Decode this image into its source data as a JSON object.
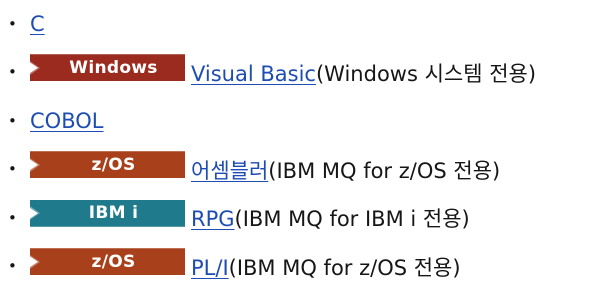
{
  "colors": {
    "link": "#1d4cb3",
    "text": "#161616",
    "badge_windows": "#9b2a1f",
    "badge_zos": "#a8401c",
    "badge_ibmi": "#1f7a8c"
  },
  "items": [
    {
      "link": "C",
      "suffix": "",
      "badge": null
    },
    {
      "link": "Visual Basic",
      "suffix": "(Windows 시스템 전용)",
      "badge": {
        "label": "Windows",
        "color": "#9b2a1f"
      }
    },
    {
      "link": "COBOL",
      "suffix": "",
      "badge": null
    },
    {
      "link": "어셈블러",
      "suffix": "(IBM MQ for z/OS 전용)",
      "badge": {
        "label": "z/OS",
        "color": "#a8401c"
      }
    },
    {
      "link": "RPG",
      "suffix": "(IBM MQ for IBM i 전용)",
      "badge": {
        "label": "IBM i",
        "color": "#1f7a8c"
      }
    },
    {
      "link": "PL/I",
      "suffix": "(IBM MQ for z/OS 전용)",
      "badge": {
        "label": "z/OS",
        "color": "#a8401c"
      }
    }
  ]
}
